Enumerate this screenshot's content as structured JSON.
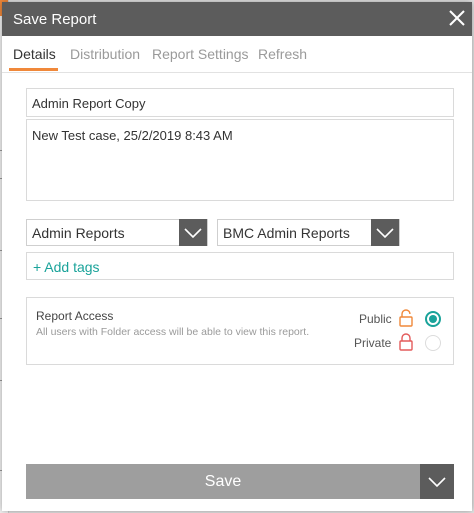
{
  "dialog": {
    "title": "Save Report",
    "close_icon": "close-icon"
  },
  "tabs": [
    {
      "label": "Details",
      "active": true
    },
    {
      "label": "Distribution",
      "active": false
    },
    {
      "label": "Report Settings",
      "active": false
    },
    {
      "label": "Refresh",
      "active": false
    }
  ],
  "form": {
    "name_value": "Admin Report Copy",
    "description_value": "New Test case, 25/2/2019 8:43 AM",
    "folder_select": {
      "value": "Admin Reports",
      "icon": "chevron-down-icon"
    },
    "subfolder_select": {
      "value": "BMC Admin Reports",
      "icon": "chevron-down-icon"
    },
    "add_tags_label": "+ Add tags"
  },
  "access": {
    "heading": "Report Access",
    "description": "All users with Folder access will be able to view this report.",
    "options": [
      {
        "label": "Public",
        "icon": "unlock-icon",
        "selected": true
      },
      {
        "label": "Private",
        "icon": "lock-icon",
        "selected": false
      }
    ]
  },
  "save": {
    "label": "Save",
    "icon": "chevron-down-icon"
  },
  "colors": {
    "titlebar": "#5c5c5c",
    "accent_orange": "#f0883a",
    "accent_teal": "#1aa39a",
    "save_button": "#9e9e9e"
  }
}
